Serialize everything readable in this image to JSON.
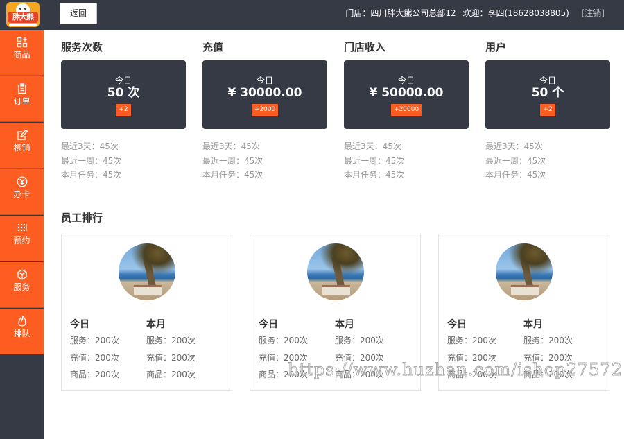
{
  "logo_text": "胖大熊",
  "header": {
    "back_label": "返回",
    "store": "门店：四川胖大熊公司总部12",
    "welcome": "欢迎：李四(18628038805)",
    "logout": "[注销]"
  },
  "sidebar": {
    "items": [
      {
        "label": "商品",
        "icon": "grid-plus-icon"
      },
      {
        "label": "订单",
        "icon": "clipboard-icon"
      },
      {
        "label": "核销",
        "icon": "edit-icon"
      },
      {
        "label": "办卡",
        "icon": "yen-circle-icon"
      },
      {
        "label": "预约",
        "icon": "dots-grid-icon"
      },
      {
        "label": "服务",
        "icon": "box-icon"
      },
      {
        "label": "排队",
        "icon": "flame-icon"
      }
    ]
  },
  "stats": [
    {
      "title": "服务次数",
      "today": "今日",
      "value": "50 次",
      "delta": "+2",
      "last3": "最近3天：45次",
      "lastweek": "最近一周：45次",
      "month": "本月任务：45次"
    },
    {
      "title": "充值",
      "today": "今日",
      "value": "¥ 30000.00",
      "delta": "+2000",
      "last3": "最近3天：45次",
      "lastweek": "最近一周：45次",
      "month": "本月任务：45次"
    },
    {
      "title": "门店收入",
      "today": "今日",
      "value": "¥ 50000.00",
      "delta": "+20000",
      "last3": "最近3天：45次",
      "lastweek": "最近一周：45次",
      "month": "本月任务：45次"
    },
    {
      "title": "用户",
      "today": "今日",
      "value": "50 个",
      "delta": "+2",
      "last3": "最近3天：45次",
      "lastweek": "最近一周：45次",
      "month": "本月任务：45次"
    }
  ],
  "ranking": {
    "title": "员工排行",
    "employees": [
      {
        "today": {
          "head": "今日",
          "service": "服务：200次",
          "recharge": "充值：200次",
          "goods": "商品：200次"
        },
        "month": {
          "head": "本月",
          "service": "服务：200次",
          "recharge": "充值：200次",
          "goods": "商品：200次"
        }
      },
      {
        "today": {
          "head": "今日",
          "service": "服务：200次",
          "recharge": "充值：200次",
          "goods": "商品：200次"
        },
        "month": {
          "head": "本月",
          "service": "服务：200次",
          "recharge": "充值：200次",
          "goods": "商品：200次"
        }
      },
      {
        "today": {
          "head": "今日",
          "service": "服务：200次",
          "recharge": "充值：200次",
          "goods": "商品：200次"
        },
        "month": {
          "head": "本月",
          "service": "服务：200次",
          "recharge": "充值：200次",
          "goods": "商品：200次"
        }
      }
    ]
  },
  "watermark": "https://www.huzhan.com/ishop27572",
  "colors": {
    "accent": "#fe5d21",
    "dark": "#363a45"
  }
}
